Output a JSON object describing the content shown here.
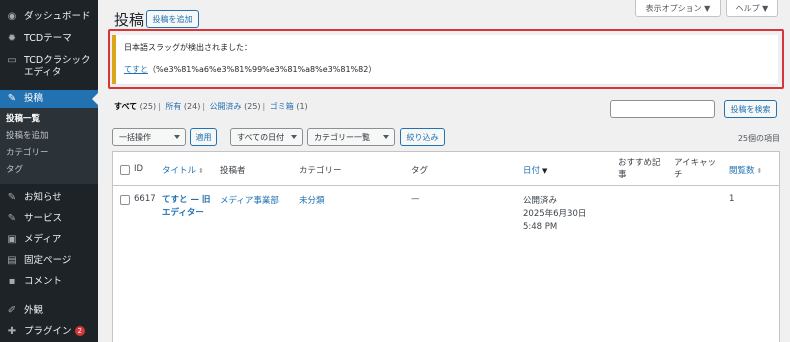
{
  "sidebar": {
    "items": [
      {
        "icon": "dashboard-icon",
        "label": "ダッシュボード"
      },
      {
        "icon": "gear-icon",
        "label": "TCDテーマ"
      },
      {
        "icon": "monitor-icon",
        "label": "TCDクラシックエディタ"
      },
      {
        "icon": "pin-icon",
        "label": "投稿"
      },
      {
        "icon": "pin-icon",
        "label": "お知らせ"
      },
      {
        "icon": "pin-icon",
        "label": "サービス"
      },
      {
        "icon": "media-icon",
        "label": "メディア"
      },
      {
        "icon": "page-icon",
        "label": "固定ページ"
      },
      {
        "icon": "comment-icon",
        "label": "コメント"
      },
      {
        "icon": "brush-icon",
        "label": "外観"
      },
      {
        "icon": "plugin-icon",
        "label": "プラグイン",
        "badge": "2"
      }
    ],
    "submenu": [
      "投稿一覧",
      "投稿を追加",
      "カテゴリー",
      "タグ"
    ]
  },
  "screen_meta": {
    "options_label": "表示オプション ▼",
    "help_label": "ヘルプ ▼"
  },
  "header": {
    "title": "投稿",
    "add_new_label": "投稿を追加"
  },
  "notice": {
    "message": "日本語スラッグが検出されました：",
    "link_text": "てすと",
    "slug_text": "（%e3%81%a6%e3%81%99%e3%81%a8%e3%81%82）"
  },
  "views": {
    "all": {
      "label": "すべて",
      "count": "(25)"
    },
    "mine": {
      "label": "所有",
      "count": "(24)"
    },
    "published": {
      "label": "公開済み",
      "count": "(25)"
    },
    "trash": {
      "label": "ゴミ箱",
      "count": "(1)"
    }
  },
  "search": {
    "placeholder": "",
    "button_label": "投稿を検索"
  },
  "tablenav": {
    "bulk_action": "一括操作",
    "apply_label": "適用",
    "date_filter": "すべての日付",
    "category_filter": "カテゴリー一覧",
    "filter_label": "絞り込み",
    "items_count": "25個の項目"
  },
  "columns": {
    "id": "ID",
    "title": "タイトル",
    "author": "投稿者",
    "categories": "カテゴリー",
    "tags": "タグ",
    "date": "日付",
    "recommend": "おすすめ記事",
    "thumbnail": "アイキャッチ",
    "views": "閲覧数"
  },
  "rows": [
    {
      "id": "6617",
      "title": "てすと — 旧エディター",
      "author": "メディア事業部",
      "category": "未分類",
      "tags": "—",
      "status": "公開済み",
      "date": "2025年6月30日 5:48 PM",
      "views": "1"
    }
  ],
  "colors": {
    "accent": "#2271b1",
    "sidebar_bg": "#1d2327",
    "notice_border": "#dba617",
    "highlight": "#d63638"
  }
}
